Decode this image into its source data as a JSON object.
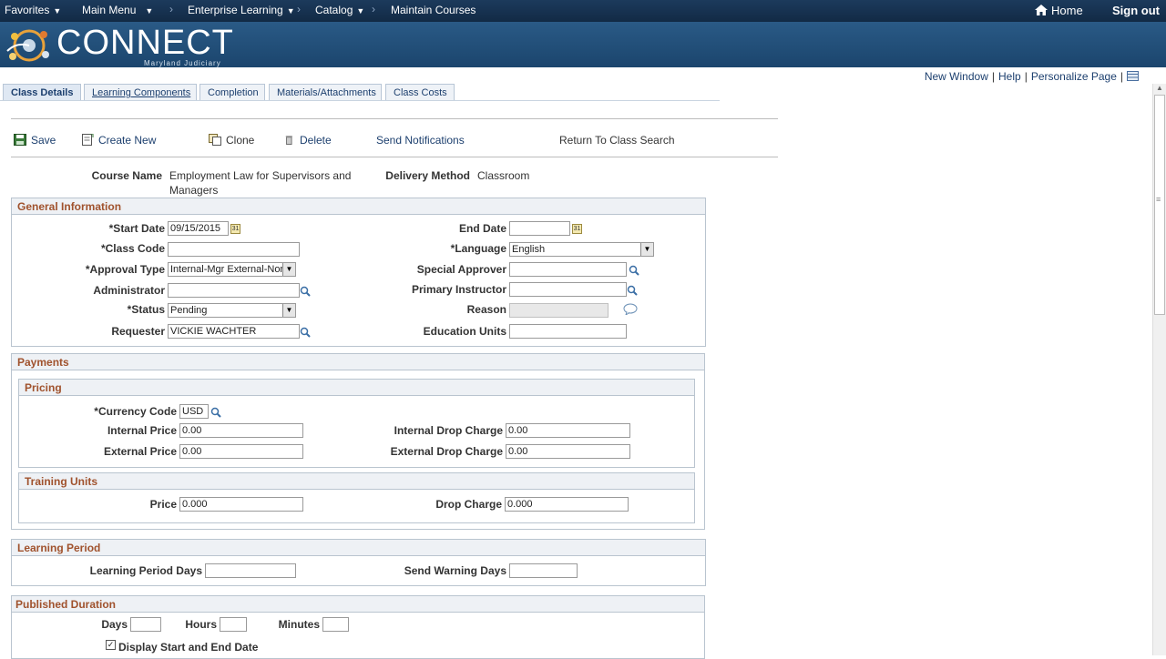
{
  "nav": {
    "favorites": "Favorites",
    "main_menu": "Main Menu",
    "enterprise_learning": "Enterprise Learning",
    "catalog": "Catalog",
    "maintain_courses": "Maintain Courses",
    "home": "Home",
    "sign_out": "Sign out"
  },
  "brand": {
    "name": "CONNECT",
    "subtitle": "Maryland Judiciary"
  },
  "page_links": {
    "new_window": "New Window",
    "help": "Help",
    "personalize": "Personalize Page"
  },
  "tabs": [
    {
      "label": "Class Details",
      "active": true
    },
    {
      "label": "Learning Components",
      "active": false
    },
    {
      "label": "Completion",
      "active": false
    },
    {
      "label": "Materials/Attachments",
      "active": false
    },
    {
      "label": "Class Costs",
      "active": false
    }
  ],
  "toolbar": {
    "save": "Save",
    "create_new": "Create New",
    "clone": "Clone",
    "delete": "Delete",
    "send_notifications": "Send Notifications",
    "return_search": "Return To Class Search"
  },
  "course": {
    "name_label": "Course Name",
    "name_line1": "Employment Law for Supervisors and",
    "name_line2": "Managers",
    "delivery_label": "Delivery Method",
    "delivery_value": "Classroom"
  },
  "general": {
    "title": "General Information",
    "start_date_label": "*Start Date",
    "start_date": "09/15/2015",
    "end_date_label": "End Date",
    "end_date": "",
    "class_code_label": "*Class Code",
    "class_code": "",
    "language_label": "*Language",
    "language": "English",
    "approval_type_label": "*Approval Type",
    "approval_type": "Internal-Mgr External-Non",
    "special_approver_label": "Special Approver",
    "special_approver": "",
    "administrator_label": "Administrator",
    "administrator": "",
    "primary_instructor_label": "Primary Instructor",
    "primary_instructor": "",
    "status_label": "*Status",
    "status": "Pending",
    "reason_label": "Reason",
    "reason": "",
    "requester_label": "Requester",
    "requester": "VICKIE WACHTER",
    "education_units_label": "Education Units",
    "education_units": ""
  },
  "payments": {
    "title": "Payments",
    "pricing_title": "Pricing",
    "currency_label": "*Currency Code",
    "currency": "USD",
    "internal_price_label": "Internal Price",
    "internal_price": "0.00",
    "internal_drop_label": "Internal Drop Charge",
    "internal_drop": "0.00",
    "external_price_label": "External Price",
    "external_price": "0.00",
    "external_drop_label": "External Drop Charge",
    "external_drop": "0.00",
    "training_units_title": "Training Units",
    "price_label": "Price",
    "price": "0.000",
    "drop_charge_label": "Drop Charge",
    "drop_charge": "0.000"
  },
  "learning_period": {
    "title": "Learning Period",
    "days_label": "Learning Period Days",
    "days": "",
    "warning_label": "Send Warning Days",
    "warning": ""
  },
  "published_duration": {
    "title": "Published Duration",
    "days_label": "Days",
    "days": "",
    "hours_label": "Hours",
    "hours": "",
    "minutes_label": "Minutes",
    "minutes": "",
    "display_dates_label": "Display Start and End Date",
    "display_dates_checked": true
  },
  "colors": {
    "nav_bg": "#1c3a5c",
    "banner_bg": "#2a5a86",
    "section_title": "#a0522d",
    "link": "#1c3f6e"
  }
}
